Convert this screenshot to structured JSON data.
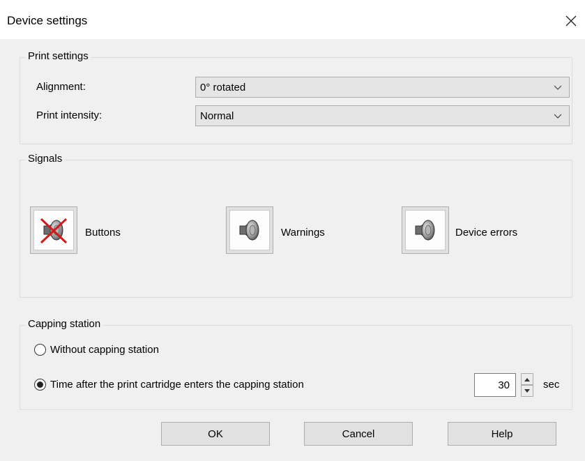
{
  "window": {
    "title": "Device settings",
    "close_glyph": "✕"
  },
  "print_settings": {
    "group_label": "Print settings",
    "alignment": {
      "label": "Alignment:",
      "value": "0° rotated"
    },
    "intensity": {
      "label": "Print intensity:",
      "value": "Normal"
    }
  },
  "signals": {
    "group_label": "Signals",
    "items": [
      {
        "label": "Buttons",
        "icon": "speaker-muted-icon",
        "muted": true
      },
      {
        "label": "Warnings",
        "icon": "speaker-icon",
        "muted": false
      },
      {
        "label": "Device errors",
        "icon": "speaker-icon",
        "muted": false
      }
    ]
  },
  "capping": {
    "group_label": "Capping station",
    "option_without": "Without capping station",
    "option_time": "Time after the print cartridge enters the capping station",
    "selected": "time",
    "time_value": "30",
    "unit": "sec"
  },
  "buttons": {
    "ok": "OK",
    "cancel": "Cancel",
    "help": "Help"
  }
}
